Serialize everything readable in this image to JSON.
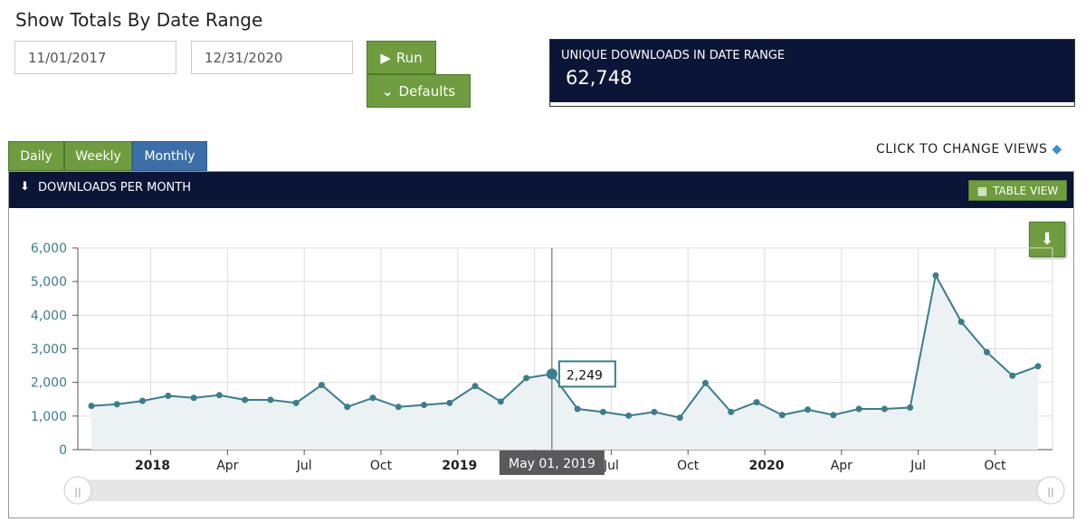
{
  "title": "Show Totals By Date Range",
  "start_date": "11/01/2017",
  "end_date": "12/31/2020",
  "run_label": "Run",
  "defaults_label": "Defaults",
  "stat": {
    "label": "UNIQUE DOWNLOADS IN DATE RANGE",
    "value": "62,748"
  },
  "tabs": [
    {
      "label": "Daily",
      "active": false
    },
    {
      "label": "Weekly",
      "active": false
    },
    {
      "label": "Monthly",
      "active": true
    }
  ],
  "change_views": "CLICK TO CHANGE VIEWS",
  "panel_title": "DOWNLOADS PER MONTH",
  "table_view": "TABLE VIEW",
  "colors": {
    "navy": "#0b1537",
    "green": "#6f9c3f",
    "blue": "#3c6fa8",
    "line": "#3a7d8b"
  },
  "tooltip": {
    "value": "2,249",
    "date": "May 01, 2019"
  },
  "chart_data": {
    "type": "area",
    "ylim": [
      0,
      6000
    ],
    "yticks": [
      "0",
      "1,000",
      "2,000",
      "3,000",
      "4,000",
      "5,000",
      "6,000"
    ],
    "xticks": [
      {
        "label": "2018",
        "bold": true
      },
      {
        "label": "Apr"
      },
      {
        "label": "Jul"
      },
      {
        "label": "Oct"
      },
      {
        "label": "2019",
        "bold": true
      },
      {
        "label": "Apr"
      },
      {
        "label": "Jul"
      },
      {
        "label": "Oct"
      },
      {
        "label": "2020",
        "bold": true
      },
      {
        "label": "Apr"
      },
      {
        "label": "Jul"
      },
      {
        "label": "Oct"
      }
    ],
    "x_start": "2017-11",
    "x_end": "2020-12",
    "values": [
      1300,
      1350,
      1450,
      1600,
      1540,
      1620,
      1480,
      1480,
      1390,
      1920,
      1270,
      1540,
      1270,
      1330,
      1390,
      1890,
      1430,
      2130,
      2249,
      1210,
      1120,
      1010,
      1120,
      950,
      1980,
      1120,
      1410,
      1030,
      1190,
      1030,
      1210,
      1210,
      1250,
      5180,
      3800,
      2900,
      2200,
      2480
    ],
    "grid": true,
    "highlight_index": 18
  }
}
